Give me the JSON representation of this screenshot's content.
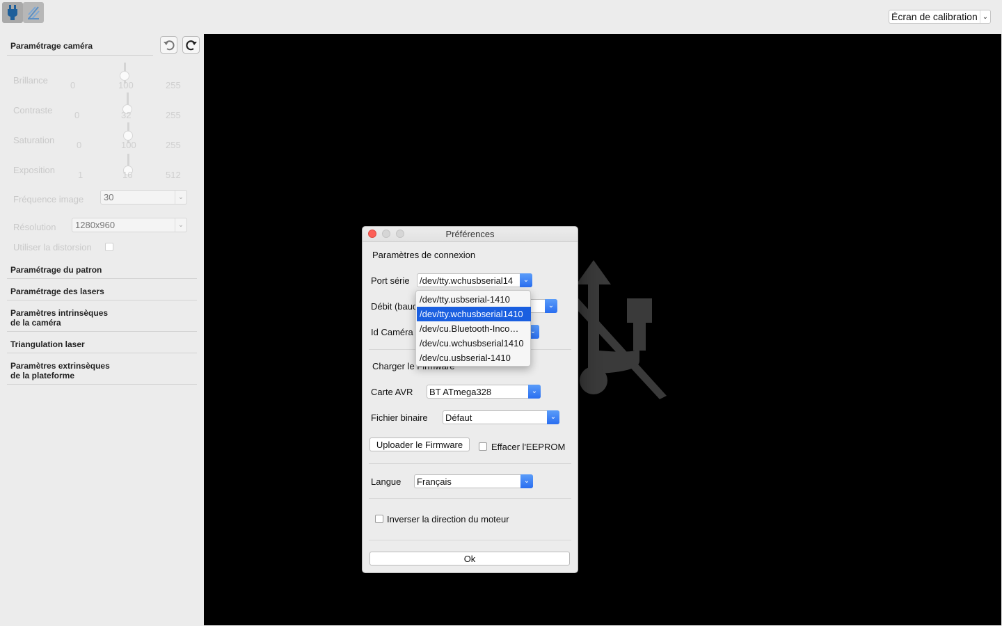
{
  "toolbar": {
    "connect_icon": "usb-plug-icon",
    "scan_icon": "laser-scan-icon",
    "view_select": {
      "value": "Écran de calibration"
    }
  },
  "sidebar": {
    "camera_title": "Paramétrage caméra",
    "undo_icon": "undo-icon",
    "refresh_icon": "refresh-icon",
    "sliders": [
      {
        "label": "Brillance",
        "min": "0",
        "value": "100",
        "max": "255"
      },
      {
        "label": "Contraste",
        "min": "0",
        "value": "32",
        "max": "255"
      },
      {
        "label": "Saturation",
        "min": "0",
        "value": "100",
        "max": "255"
      },
      {
        "label": "Exposition",
        "min": "1",
        "value": "16",
        "max": "512"
      }
    ],
    "framerate": {
      "label": "Fréquence image",
      "value": "30"
    },
    "resolution": {
      "label": "Résolution",
      "value": "1280x960"
    },
    "distortion": {
      "label": "Utiliser la distorsion"
    },
    "sections": [
      {
        "line1": "Paramétrage du patron",
        "line2": ""
      },
      {
        "line1": "Paramétrage des lasers",
        "line2": ""
      },
      {
        "line1": "Paramètres intrinsèques",
        "line2": "de la caméra"
      },
      {
        "line1": "Triangulation laser",
        "line2": ""
      },
      {
        "line1": "Paramètres extrinsèques",
        "line2": "de la plateforme"
      }
    ]
  },
  "dialog": {
    "title": "Préférences",
    "connection_title": "Paramètres de connexion",
    "serial_port": {
      "label": "Port série",
      "value": "/dev/tty.wchusbserial14"
    },
    "baud": {
      "label": "Débit (baud"
    },
    "camera_id": {
      "label": "Id Caméra"
    },
    "firmware_title": "Charger le Firmware",
    "avr_board": {
      "label": "Carte AVR",
      "value": "BT ATmega328"
    },
    "binary_file": {
      "label": "Fichier binaire",
      "value": "Défaut"
    },
    "upload_button": "Uploader le Firmware",
    "erase_eeprom": "Effacer l'EEPROM",
    "language": {
      "label": "Langue",
      "value": "Français"
    },
    "invert_motor": "Inverser la direction du moteur",
    "ok_button": "Ok"
  },
  "port_popup": {
    "options": [
      "/dev/tty.usbserial-1410",
      "/dev/tty.wchusbserial1410",
      "/dev/cu.Bluetooth-Inco…",
      "/dev/cu.wchusbserial1410",
      "/dev/cu.usbserial-1410"
    ],
    "selected": "/dev/tty.wchusbserial1410"
  },
  "video": {
    "placeholder_icon": "usb-disconnected-icon"
  }
}
